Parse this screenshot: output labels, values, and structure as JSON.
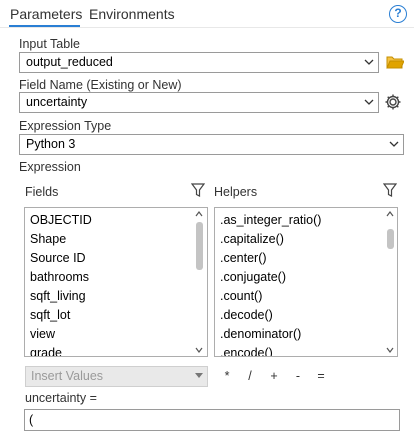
{
  "tabs": [
    {
      "label": "Parameters",
      "active": true
    },
    {
      "label": "Environments",
      "active": false
    }
  ],
  "help_icon": "question-mark-icon",
  "input_table": {
    "label": "Input Table",
    "value": "output_reduced"
  },
  "field_name": {
    "label": "Field Name (Existing or New)",
    "value": "uncertainty"
  },
  "expression_type": {
    "label": "Expression Type",
    "value": "Python 3"
  },
  "expression_section": {
    "label": "Expression",
    "fields_header": "Fields",
    "helpers_header": "Helpers",
    "fields": [
      "OBJECTID",
      "Shape",
      "Source ID",
      "bathrooms",
      "sqft_living",
      "sqft_lot",
      "view",
      "grade"
    ],
    "helpers": [
      ".as_integer_ratio()",
      ".capitalize()",
      ".center()",
      ".conjugate()",
      ".count()",
      ".decode()",
      ".denominator()",
      ".encode()"
    ],
    "insert_values": "Insert Values",
    "operators": [
      "*",
      "/",
      "+",
      "-",
      "="
    ],
    "expression_label": "uncertainty =",
    "expression_value": "("
  },
  "colors": {
    "accent": "#2a7fd4",
    "folder": "#e0a300"
  }
}
